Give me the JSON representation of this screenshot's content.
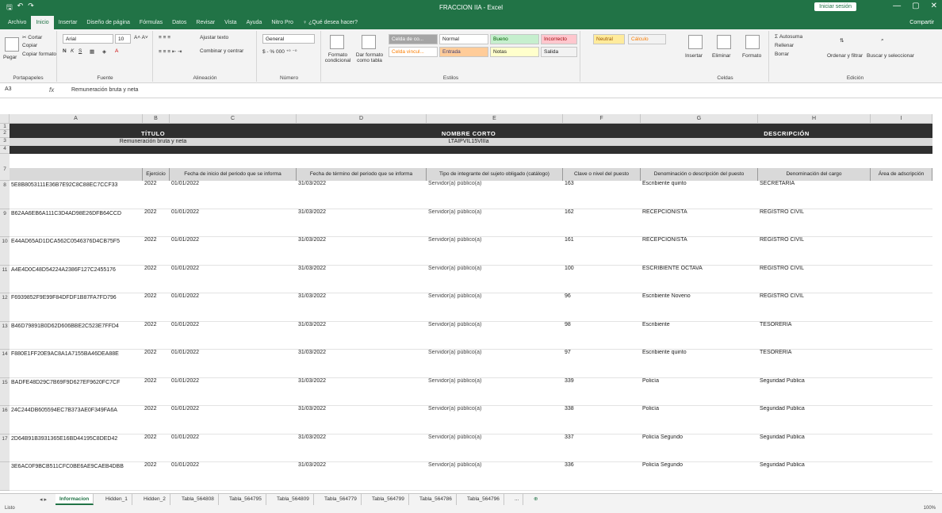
{
  "window": {
    "title": "FRACCION IIA - Excel",
    "signin_label": "Iniciar sesión",
    "controls": [
      "—",
      "▢",
      "✕"
    ]
  },
  "quick_access": [
    "save-icon",
    "undo-icon",
    "redo-icon"
  ],
  "tabs": [
    "Archivo",
    "Inicio",
    "Insertar",
    "Diseño de página",
    "Fórmulas",
    "Datos",
    "Revisar",
    "Vista",
    "Ayuda",
    "Nitro Pro"
  ],
  "tell_me": "¿Qué desea hacer?",
  "share_label": "Compartir",
  "ribbon": {
    "clipboard": {
      "paste": "Pegar",
      "cut": "Cortar",
      "copy": "Copiar",
      "format_painter": "Copiar formato",
      "group": "Portapapeles"
    },
    "font": {
      "name": "Arial",
      "size": "10",
      "group": "Fuente"
    },
    "alignment": {
      "wrap": "Ajustar texto",
      "merge": "Combinar y centrar",
      "group": "Alineación"
    },
    "number": {
      "format": "General",
      "group": "Número"
    },
    "styles": {
      "conditional": "Formato condicional",
      "table": "Dar formato como tabla",
      "cells": [
        "Celda de co...",
        "Normal",
        "Bueno",
        "Incorrecto",
        "Neutral",
        "Cálculo",
        "Celda vincul...",
        "Entrada",
        "Notas",
        "Salida"
      ],
      "group": "Estilos"
    },
    "cells": {
      "insert": "Insertar",
      "delete": "Eliminar",
      "format": "Formato",
      "group": "Celdas"
    },
    "editing": {
      "autosum": "Autosuma",
      "fill": "Rellenar",
      "clear": "Borrar",
      "sort": "Ordenar y filtrar",
      "find": "Buscar y seleccionar",
      "group": "Edición"
    }
  },
  "formula_bar": {
    "name_box": "A3",
    "fx": "fx",
    "content": "Remuneración bruta y neta"
  },
  "columns": [
    "A",
    "B",
    "C",
    "D",
    "E",
    "F",
    "G",
    "H",
    "I"
  ],
  "sheet": {
    "row_numbers": [
      "1",
      "2",
      "3",
      "4",
      "7",
      "8",
      "9",
      "10",
      "11",
      "12",
      "13",
      "14",
      "15",
      "16",
      "17"
    ],
    "banner": {
      "titulo": "TÍTULO",
      "nombre_corto": "NOMBRE CORTO",
      "descripcion": "DESCRIPCIÓN"
    },
    "subheader": {
      "titulo_value": "Remuneración bruta y neta",
      "nombre_corto_value": "LTAIPVIL15VIIIa",
      "descripcion_value": ""
    },
    "headers": [
      "",
      "Ejercicio",
      "Fecha de inicio del periodo que se informa",
      "Fecha de término del periodo que se informa",
      "Tipo de integrante del sujeto obligado (catálogo)",
      "Clave o nivel del puesto",
      "Denominación o descripción del puesto",
      "Denominación del cargo",
      "Área de adscripción"
    ],
    "rows": [
      [
        "5E8B8053111E36B7E92C8C88EC7CCF33",
        "2022",
        "01/01/2022",
        "31/03/2022",
        "Servidor(a) público(a)",
        "163",
        "Escribiente quinto",
        "SECRETARIA"
      ],
      [
        "B62AA6EB6A111C3D4AD98E26DFB64CCD",
        "2022",
        "01/01/2022",
        "31/03/2022",
        "Servidor(a) público(a)",
        "162",
        "RECEPCIONISTA",
        "REGISTRO CIVIL"
      ],
      [
        "E44AD65AD1DCA562C0546376D4CB75F5",
        "2022",
        "01/01/2022",
        "31/03/2022",
        "Servidor(a) público(a)",
        "161",
        "RECEPCIONISTA",
        "REGISTRO CIVIL"
      ],
      [
        "A4E4D0C48D54224A2386F127C2455176",
        "2022",
        "01/01/2022",
        "31/03/2022",
        "Servidor(a) público(a)",
        "100",
        "ESCRIBIENTE OCTAVA",
        "REGISTRO CIVIL"
      ],
      [
        "F6939852F9E99F84DFDF1B87FA7FD796",
        "2022",
        "01/01/2022",
        "31/03/2022",
        "Servidor(a) público(a)",
        "96",
        "Escribiente Noveno",
        "REGISTRO CIVIL"
      ],
      [
        "B46D79891B0D62D606BBE2C523E7FFD4",
        "2022",
        "01/01/2022",
        "31/03/2022",
        "Servidor(a) público(a)",
        "98",
        "Escribiente",
        "TESORERIA"
      ],
      [
        "F880E1FF20E9AC8A1A7155BA46DEA88E",
        "2022",
        "01/01/2022",
        "31/03/2022",
        "Servidor(a) público(a)",
        "97",
        "Escribiente quinto",
        "TESORERIA"
      ],
      [
        "BADFE48D29C7B69F9D627EF9620FC7CF",
        "2022",
        "01/01/2022",
        "31/03/2022",
        "Servidor(a) público(a)",
        "339",
        "Policía",
        "Seguridad Publica"
      ],
      [
        "24C244DB605594EC7B373AE0F349FA6A",
        "2022",
        "01/01/2022",
        "31/03/2022",
        "Servidor(a) público(a)",
        "338",
        "Policía",
        "Seguridad Publica"
      ],
      [
        "2D64B91B3931365E16BD44195C8DED42",
        "2022",
        "01/01/2022",
        "31/03/2022",
        "Servidor(a) público(a)",
        "337",
        "Policía Segundo",
        "Seguridad Publica"
      ],
      [
        "3E6AC0F9BCB511CFC0BE6AE9CAEB4DBB",
        "2022",
        "01/01/2022",
        "31/03/2022",
        "Servidor(a) público(a)",
        "336",
        "Policía Segundo",
        "Seguridad Publica"
      ]
    ]
  },
  "sheet_tabs": [
    "Informacion",
    "Hidden_1",
    "Hidden_2",
    "Tabla_564808",
    "Tabla_564795",
    "Tabla_564809",
    "Tabla_564779",
    "Tabla_564799",
    "Tabla_564786",
    "Tabla_564796",
    "..."
  ],
  "status": {
    "left": "Listo",
    "zoom": "100%"
  }
}
